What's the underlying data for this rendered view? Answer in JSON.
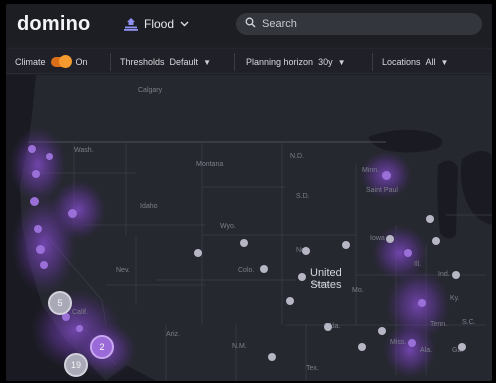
{
  "header": {
    "logo": "domino",
    "hazard_label": "Flood",
    "search_placeholder": "Search"
  },
  "filters": {
    "climate_label": "Climate",
    "climate_value": "On",
    "thresholds_label": "Thresholds",
    "thresholds_value": "Default",
    "planning_label": "Planning horizon",
    "planning_value": "30y",
    "locations_label": "Locations",
    "locations_value": "All"
  },
  "map": {
    "country_label_line1": "United",
    "country_label_line2": "States",
    "place_labels": [
      "Calgary",
      "Wash.",
      "Montana",
      "N.D.",
      "Minn.",
      "Saint Paul",
      "Idaho",
      "S.D.",
      "Wyo.",
      "Neb.",
      "Nev.",
      "Colo.",
      "Kans.",
      "Iowa",
      "Mo.",
      "Okla.",
      "Ariz.",
      "N.M.",
      "Tex.",
      "Calif.",
      "Ill.",
      "Ind.",
      "Ky.",
      "Tenn.",
      "Miss.",
      "Ala.",
      "Ga.",
      "S.C."
    ],
    "cluster_counts": [
      "5",
      "2",
      "19"
    ]
  },
  "colors": {
    "accent_toggle": "#f49a2e",
    "risk_purple": "#9a6ad8",
    "location_marker": "#b6b6c4"
  },
  "icons": {
    "hazard": "flood-icon",
    "search": "search-icon",
    "dropdown": "chevron-down-icon"
  }
}
